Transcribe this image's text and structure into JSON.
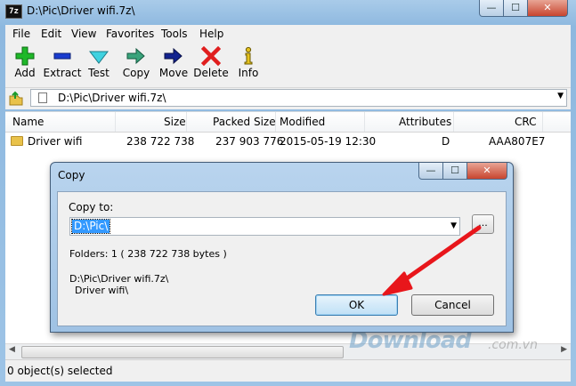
{
  "window": {
    "icon_text": "7z",
    "title": "D:\\Pic\\Driver wifi.7z\\",
    "controls": {
      "minimize": "—",
      "maximize": "☐",
      "close": "✕"
    }
  },
  "menu": [
    "File",
    "Edit",
    "View",
    "Favorites",
    "Tools",
    "Help"
  ],
  "toolbar": {
    "add": "Add",
    "extract": "Extract",
    "test": "Test",
    "copy": "Copy",
    "move": "Move",
    "delete": "Delete",
    "info": "Info"
  },
  "address": {
    "path": "D:\\Pic\\Driver wifi.7z\\"
  },
  "columns": {
    "name": "Name",
    "size": "Size",
    "packed": "Packed Size",
    "modified": "Modified",
    "attributes": "Attributes",
    "crc": "CRC"
  },
  "rows": [
    {
      "name": "Driver wifi",
      "size": "238 722 738",
      "packed": "237 903 776",
      "modified": "2015-05-19 12:30",
      "attributes": "D",
      "crc": "AAA807E7"
    }
  ],
  "status": {
    "text": "0 object(s) selected"
  },
  "watermark": {
    "brand": "Download",
    "domain": ".com.vn"
  },
  "dialog": {
    "title": "Copy",
    "copy_to_label": "Copy to:",
    "destination": "D:\\Pic\\",
    "browse_label": "...",
    "folders_info": "Folders: 1    ( 238 722 738 bytes )",
    "source_archive": "D:\\Pic\\Driver wifi.7z\\",
    "source_item": "Driver wifi\\",
    "ok_label": "OK",
    "cancel_label": "Cancel"
  },
  "colors": {
    "annotation_arrow": "#e8161b",
    "selection": "#3399ff",
    "add_icon": "#1fb829",
    "extract_icon": "#1a3ccf",
    "delete_icon": "#e01e1e"
  }
}
